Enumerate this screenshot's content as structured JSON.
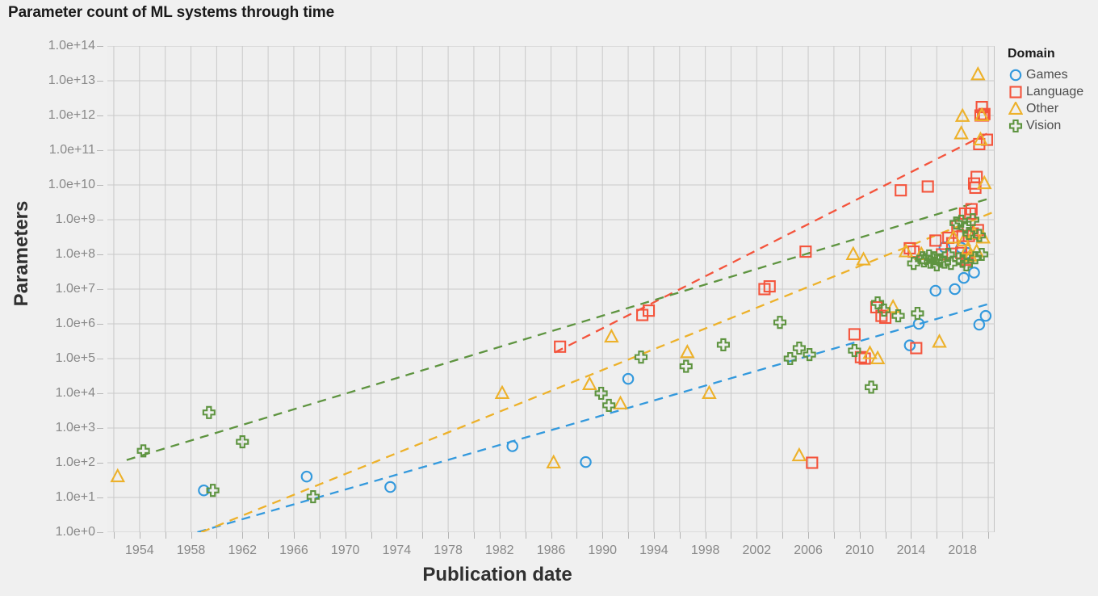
{
  "title": "Parameter count of ML systems through time",
  "axes": {
    "x_title": "Publication date",
    "y_title": "Parameters",
    "y_ticks": [
      "1.0e+0",
      "1.0e+1",
      "1.0e+2",
      "1.0e+3",
      "1.0e+4",
      "1.0e+5",
      "1.0e+6",
      "1.0e+7",
      "1.0e+8",
      "1.0e+9",
      "1.0e+10",
      "1.0e+11",
      "1.0e+12",
      "1.0e+13",
      "1.0e+14"
    ],
    "x_ticks": [
      "1954",
      "1958",
      "1962",
      "1966",
      "1970",
      "1974",
      "1978",
      "1982",
      "1986",
      "1990",
      "1994",
      "1998",
      "2002",
      "2006",
      "2010",
      "2014",
      "2018"
    ]
  },
  "legend": {
    "title": "Domain",
    "entries": [
      {
        "label": "Games",
        "marker": "circle-marker",
        "color": "#3399dd"
      },
      {
        "label": "Language",
        "marker": "square-marker",
        "color": "#f4543c"
      },
      {
        "label": "Other",
        "marker": "triangle-marker",
        "color": "#edb12a"
      },
      {
        "label": "Vision",
        "marker": "cross-marker",
        "color": "#5e9440"
      }
    ]
  },
  "colors": {
    "games": "#3399dd",
    "language": "#f4543c",
    "other": "#edb12a",
    "vision": "#5e9440",
    "plot_background": "#efefef",
    "page_background": "#f0f0f0",
    "gridline": "#c9c9c9",
    "tick_text": "#888888"
  },
  "chart_data": {
    "type": "scatter",
    "title": "Parameter count of ML systems through time",
    "xlabel": "Publication date",
    "ylabel": "Parameters",
    "xlim": [
      1951.5,
      2020.5
    ],
    "ylim_log10": [
      0,
      14
    ],
    "y_scale": "log",
    "grid": true,
    "legend_position": "right",
    "series": [
      {
        "name": "Games",
        "marker": "circle",
        "color": "#3399dd",
        "points": [
          [
            1959.0,
            16.0
          ],
          [
            1967.0,
            40.0
          ],
          [
            1973.5,
            20.0
          ],
          [
            1983.0,
            300.0
          ],
          [
            1988.7,
            105.0
          ],
          [
            1992.0,
            26000.0
          ],
          [
            2013.9,
            240000.0
          ],
          [
            2014.6,
            1000000.0
          ],
          [
            2015.9,
            9000000.0
          ],
          [
            2016.6,
            160000000.0
          ],
          [
            2017.4,
            10000000.0
          ],
          [
            2017.9,
            155000000.0
          ],
          [
            2018.1,
            21000000.0
          ],
          [
            2018.4,
            110000000.0
          ],
          [
            2019.3,
            950000.0
          ],
          [
            2019.8,
            1700000.0
          ],
          [
            2018.9,
            30000000.0
          ]
        ],
        "trend": {
          "x": [
            1958.5,
            2020.3
          ],
          "y": [
            1.0,
            4000000.0
          ]
        }
      },
      {
        "name": "Language",
        "marker": "square",
        "color": "#f4543c",
        "points": [
          [
            1986.7,
            220000.0
          ],
          [
            1993.1,
            1800000.0
          ],
          [
            1993.6,
            2400000.0
          ],
          [
            2002.6,
            10000000.0
          ],
          [
            2003.0,
            12000000.0
          ],
          [
            2005.8,
            120000000.0
          ],
          [
            2006.3,
            100.0
          ],
          [
            2009.6,
            500000.0
          ],
          [
            2010.1,
            110000.0
          ],
          [
            2010.4,
            100000.0
          ],
          [
            2011.3,
            3000000.0
          ],
          [
            2011.7,
            1700000.0
          ],
          [
            2012.0,
            1500000.0
          ],
          [
            2013.2,
            7000000000.0
          ],
          [
            2013.9,
            150000000.0
          ],
          [
            2014.2,
            120000000.0
          ],
          [
            2014.4,
            200000.0
          ],
          [
            2015.3,
            9000000000.0
          ],
          [
            2015.9,
            250000000.0
          ],
          [
            2016.4,
            100000000.0
          ],
          [
            2016.9,
            300000000.0
          ],
          [
            2017.2,
            210000000.0
          ],
          [
            2017.6,
            650000000.0
          ],
          [
            2017.9,
            110000000.0
          ],
          [
            2018.0,
            340000000.0
          ],
          [
            2018.2,
            1500000000.0
          ],
          [
            2018.4,
            80000000.0
          ],
          [
            2018.5,
            340000000.0
          ],
          [
            2018.6,
            1500000000.0
          ],
          [
            2018.7,
            2000000000.0
          ],
          [
            2018.8,
            400000000.0
          ],
          [
            2018.9,
            11000000000.0
          ],
          [
            2019.0,
            8300000000.0
          ],
          [
            2019.1,
            17000000000.0
          ],
          [
            2019.3,
            150000000000.0
          ],
          [
            2019.4,
            1000000000000.0
          ],
          [
            2019.5,
            1750000000000.0
          ],
          [
            2019.6,
            1000000000000.0
          ],
          [
            2019.7,
            1100000000000.0
          ],
          [
            2019.9,
            200000000000.0
          ],
          [
            2019.2,
            500000000.0
          ],
          [
            2018.3,
            70000000.0
          ]
        ],
        "trend": {
          "x": [
            1986.3,
            2019.9
          ],
          "y": [
            150000.0,
            300000000000.0
          ]
        }
      },
      {
        "name": "Other",
        "marker": "triangle",
        "color": "#edb12a",
        "points": [
          [
            1952.3,
            40.0
          ],
          [
            1982.2,
            10000.0
          ],
          [
            1986.2,
            100.0
          ],
          [
            1989.0,
            18000.0
          ],
          [
            1990.7,
            420000.0
          ],
          [
            1991.4,
            5000.0
          ],
          [
            1996.6,
            150000.0
          ],
          [
            1998.3,
            10000.0
          ],
          [
            2005.3,
            160.0
          ],
          [
            2009.5,
            100000000.0
          ],
          [
            2010.3,
            70000000.0
          ],
          [
            2010.8,
            140000.0
          ],
          [
            2011.4,
            100000.0
          ],
          [
            2012.6,
            3000000.0
          ],
          [
            2013.6,
            120000000.0
          ],
          [
            2014.8,
            100000000.0
          ],
          [
            2016.2,
            300000.0
          ],
          [
            2017.3,
            300000000.0
          ],
          [
            2018.1,
            250000000.0
          ],
          [
            2018.4,
            140000000.0
          ],
          [
            2018.6,
            90000000.0
          ],
          [
            2018.9,
            400000000.0
          ],
          [
            2019.1,
            120000000.0
          ],
          [
            2019.2,
            15000000000000.0
          ],
          [
            2019.4,
            200000000000.0
          ],
          [
            2019.5,
            1000000000000.0
          ],
          [
            2019.6,
            300000000.0
          ],
          [
            2019.7,
            11000000000.0
          ],
          [
            2018.0,
            950000000000.0
          ],
          [
            2017.9,
            300000000000.0
          ]
        ],
        "trend": {
          "x": [
            1958.8,
            2020.3
          ],
          "y": [
            1.0,
            1600000000.0
          ]
        }
      },
      {
        "name": "Vision",
        "marker": "cross",
        "color": "#5e9440",
        "points": [
          [
            1954.3,
            220.0
          ],
          [
            1959.4,
            2800.0
          ],
          [
            1959.7,
            16.0
          ],
          [
            1962.0,
            400.0
          ],
          [
            1967.5,
            10.5
          ],
          [
            1989.9,
            10000.0
          ],
          [
            1990.5,
            4500.0
          ],
          [
            1993.0,
            110000.0
          ],
          [
            1996.5,
            60000.0
          ],
          [
            1999.4,
            250000.0
          ],
          [
            2003.8,
            1100000.0
          ],
          [
            2004.6,
            100000.0
          ],
          [
            2005.3,
            200000.0
          ],
          [
            2006.1,
            130000.0
          ],
          [
            2009.6,
            170000.0
          ],
          [
            2010.9,
            15000.0
          ],
          [
            2011.4,
            4000000.0
          ],
          [
            2011.9,
            2500000.0
          ],
          [
            2013.0,
            1700000.0
          ],
          [
            2014.5,
            2000000.0
          ],
          [
            2015.0,
            65000000.0
          ],
          [
            2015.8,
            80000000.0
          ],
          [
            2016.2,
            70000000.0
          ],
          [
            2016.6,
            60000000.0
          ],
          [
            2017.1,
            55000000.0
          ],
          [
            2017.5,
            800000000.0
          ],
          [
            2017.9,
            900000000.0
          ],
          [
            2018.2,
            600000000.0
          ],
          [
            2018.5,
            400000000.0
          ],
          [
            2018.8,
            1000000000.0
          ],
          [
            2019.0,
            80000000.0
          ],
          [
            2019.3,
            350000000.0
          ],
          [
            2019.5,
            100000000.0
          ],
          [
            2014.9,
            80000000.0
          ],
          [
            2015.4,
            90000000.0
          ],
          [
            2016.9,
            100000000.0
          ],
          [
            2017.7,
            75000000.0
          ],
          [
            2018.0,
            65000000.0
          ],
          [
            2018.3,
            50000000.0
          ],
          [
            2016.0,
            50000000.0
          ],
          [
            2015.5,
            60000000.0
          ],
          [
            2014.2,
            55000000.0
          ]
        ],
        "trend": {
          "x": [
            1953.0,
            2020.0
          ],
          "y": [
            120.0,
            4000000000.0
          ]
        }
      }
    ]
  }
}
